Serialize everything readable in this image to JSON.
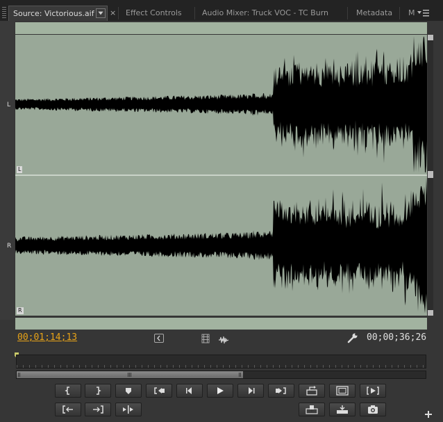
{
  "tabs": [
    {
      "label": "Source: Victorious.aif",
      "active": true
    },
    {
      "label": "Effect Controls",
      "active": false
    },
    {
      "label": "Audio Mixer: Truck VOC - TC Burn",
      "active": false
    },
    {
      "label": "Metadata",
      "active": false
    },
    {
      "label": "M",
      "active": false
    }
  ],
  "channels": {
    "left": {
      "side_label": "L",
      "corner_label": "L"
    },
    "right": {
      "side_label": "R",
      "corner_label": "R"
    }
  },
  "timecode": {
    "current": "00;01;14;13",
    "duration": "00;00;36;26"
  },
  "colors": {
    "accent_timecode": "#e8a317",
    "waveform_bg": "#99a898",
    "waveform": "#000000"
  }
}
